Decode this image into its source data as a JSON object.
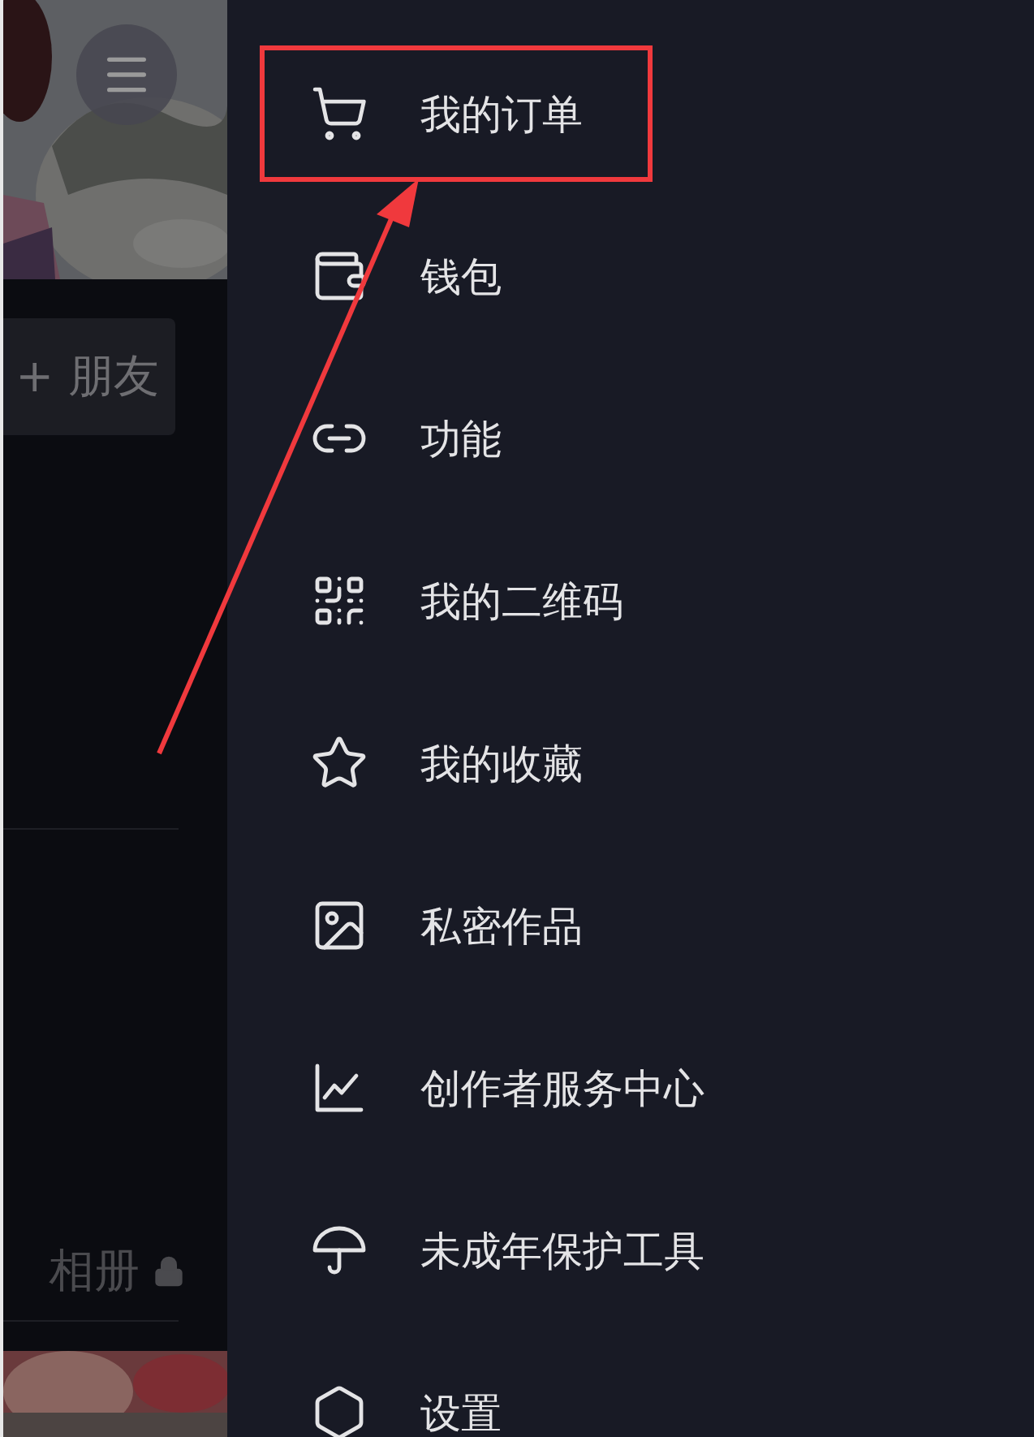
{
  "profile_panel": {
    "add_friend_button": "+ 朋友",
    "album_label": "相册"
  },
  "drawer": {
    "items": [
      {
        "label": "我的订单",
        "highlighted": true
      },
      {
        "label": "钱包",
        "highlighted": false
      },
      {
        "label": "功能",
        "highlighted": false
      },
      {
        "label": "我的二维码",
        "highlighted": false
      },
      {
        "label": "我的收藏",
        "highlighted": false
      },
      {
        "label": "私密作品",
        "highlighted": false
      },
      {
        "label": "创作者服务中心",
        "highlighted": false
      },
      {
        "label": "未成年保护工具",
        "highlighted": false
      },
      {
        "label": "设置",
        "highlighted": false
      }
    ]
  }
}
